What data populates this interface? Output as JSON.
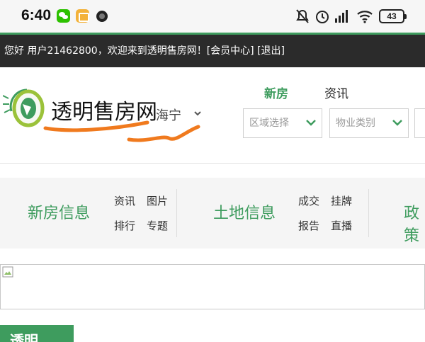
{
  "status_bar": {
    "time": "6:40",
    "battery": "43",
    "icons": [
      "wechat-icon",
      "notes-icon",
      "dot-icon",
      "mute-icon",
      "alarm-icon",
      "signal-icon",
      "wifi-icon",
      "battery-icon"
    ]
  },
  "welcome": {
    "text": "您好 用户21462800，欢迎来到透明售房网！[会员中心] [退出]"
  },
  "header": {
    "logo_text": "透明售房网",
    "city": "海宁",
    "tabs": [
      {
        "label": "新房",
        "active": true
      },
      {
        "label": "资讯",
        "active": false
      }
    ],
    "selects": [
      {
        "placeholder": "区域选择"
      },
      {
        "placeholder": "物业类别"
      }
    ]
  },
  "categories": [
    {
      "title": "新房信息",
      "links": [
        "资讯",
        "图片",
        "排行",
        "专题"
      ]
    },
    {
      "title": "土地信息",
      "links": [
        "成交",
        "挂牌",
        "报告",
        "直播"
      ]
    },
    {
      "title": "政策",
      "links": []
    }
  ],
  "bottom": {
    "green_label": "透明",
    "text_fragment": "..."
  },
  "colors": {
    "accent": "#3e9c5e",
    "welcome_bg": "#2b2b2b",
    "scribble": "#f07a1e"
  }
}
